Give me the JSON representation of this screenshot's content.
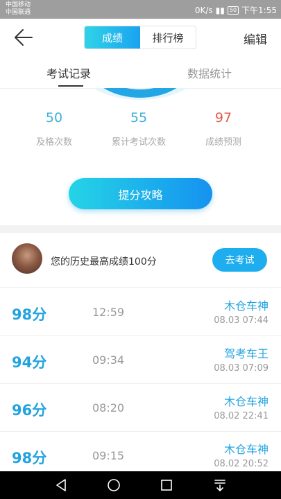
{
  "status_bar": {
    "carrier1": "中国移动",
    "carrier2": "中国联通",
    "speed": "0K/s",
    "battery": "50",
    "time": "下午1:55"
  },
  "header": {
    "seg_scores": "成绩",
    "seg_ranking": "排行榜",
    "edit": "编辑"
  },
  "tabs": {
    "records": "考试记录",
    "stats": "数据统计"
  },
  "stats": [
    {
      "value": "50",
      "label": "及格次数",
      "color": "#3ab0d8"
    },
    {
      "value": "55",
      "label": "累计考试次数",
      "color": "#3ab0d8"
    },
    {
      "value": "97",
      "label": "成绩预测",
      "color": "#e05a4e"
    }
  ],
  "strategy_button": "提分攻略",
  "best": {
    "text": "您的历史最高成绩100分",
    "button": "去考试"
  },
  "records": [
    {
      "score": "98分",
      "duration": "12:59",
      "title": "木仓车神",
      "date": "08.03  07:44"
    },
    {
      "score": "94分",
      "duration": "09:34",
      "title": "驾考车王",
      "date": "08.03  07:09"
    },
    {
      "score": "96分",
      "duration": "08:20",
      "title": "木仓车神",
      "date": "08.02  22:41"
    },
    {
      "score": "98分",
      "duration": "09:15",
      "title": "木仓车神",
      "date": "08.02  20:52"
    }
  ]
}
